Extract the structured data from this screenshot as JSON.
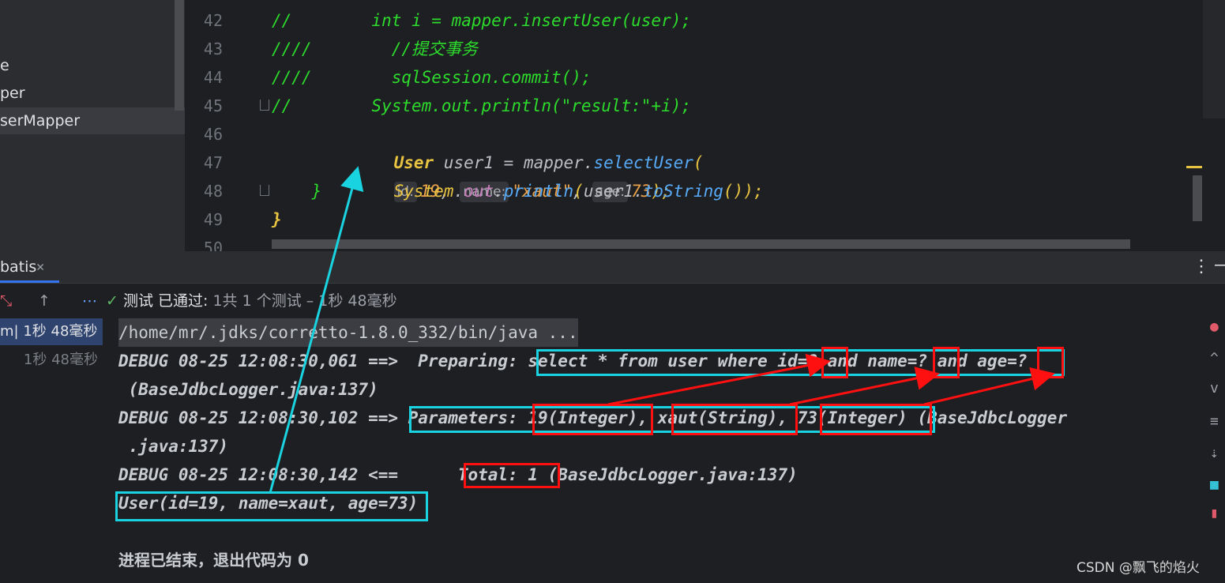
{
  "project_tree": {
    "items": [
      {
        "label": "e"
      },
      {
        "label": "per"
      },
      {
        "label": "serMapper",
        "selected": true
      }
    ]
  },
  "editor": {
    "lines": [
      {
        "num": "42",
        "segments": [
          {
            "t": "//        int i = mapper.insertUser(user);",
            "c": "cm"
          }
        ]
      },
      {
        "num": "43",
        "segments": [
          {
            "t": "////        //提交事务",
            "c": "cm"
          }
        ]
      },
      {
        "num": "44",
        "segments": [
          {
            "t": "////        sqlSession.commit();",
            "c": "cm"
          }
        ]
      },
      {
        "num": "45",
        "segments": [
          {
            "t": "//        System.out.println(\"result:\"+i);",
            "c": "cm"
          }
        ]
      },
      {
        "num": "46",
        "segments": []
      },
      {
        "num": "47",
        "segments": []
      },
      {
        "num": "48",
        "segments": [
          {
            "t": "    }",
            "c": "cm"
          }
        ]
      },
      {
        "num": "49",
        "segments": [
          {
            "t": "}",
            "c": "br"
          }
        ]
      },
      {
        "num": "50",
        "segments": []
      }
    ],
    "line46": {
      "type": "User",
      "var": " user1 = ",
      "obj": "mapper",
      "dot": ".",
      "method": "selectUser",
      "open": "(",
      "hint_id": "id:",
      "val_id": "19",
      "comma1": ", ",
      "hint_name": "name:",
      "val_name": "\"xaut\"",
      "comma2": ", ",
      "hint_age": "age:",
      "val_age": "73",
      "close": ");"
    },
    "line47": {
      "cls": "System",
      "dot1": ".",
      "field": "out",
      "dot2": ".",
      "method": "println",
      "open": "(",
      "arg": "user1",
      "dot3": ".",
      "method2": "toString",
      "parens": "()",
      "close": ");"
    }
  },
  "run_panel": {
    "tab_label": "batis",
    "close_glyph": "✕",
    "kebab": "⋮",
    "minimize": "—",
    "toolbar": {
      "collapse_icon": "⤡",
      "up_icon": "↑",
      "more_icon": "⋯",
      "status_icon": "✓",
      "status_label": "测试 已通过:",
      "status_detail": " 1共 1 个测试 – 1秒 48毫秒"
    },
    "test_tree": {
      "root": "m| 1秒 48毫秒",
      "child": "1秒 48毫秒"
    },
    "console": {
      "path": "/home/mr/.jdks/corretto-1.8.0_332/bin/java ...",
      "l1": "DEBUG 08-25 12:08:30,061 ==>  Preparing: select * from user where id=? and name=? and age=?",
      "l2": " (BaseJdbcLogger.java:137)",
      "l3": "DEBUG 08-25 12:08:30,102 ==> Parameters: 19(Integer), xaut(String), 73(Integer) (BaseJdbcLogger",
      "l4": " .java:137)",
      "l5": "DEBUG 08-25 12:08:30,142 <==      Total: 1 (BaseJdbcLogger.java:137)",
      "l6": "User(id=19, name=xaut, age=73)",
      "exit": "进程已结束，退出代码为 0"
    }
  },
  "watermark": "CSDN @飘飞的焰火",
  "colors": {
    "annotation_cyan": "#19d3e0",
    "annotation_red": "#ff1010",
    "comment_green": "#2ddb2d"
  }
}
